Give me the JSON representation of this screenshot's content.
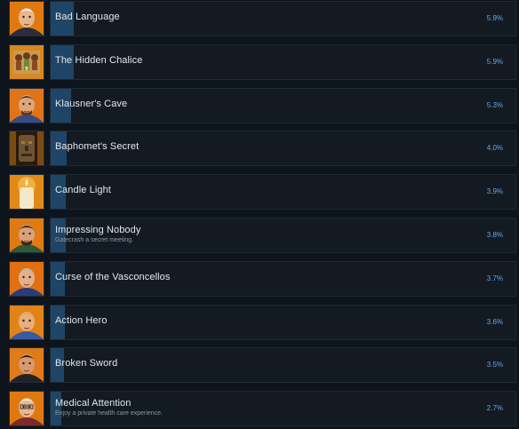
{
  "achievements": [
    {
      "title": "Bad Language",
      "description": "",
      "percent_label": "5.9%",
      "percent": 5.9,
      "icon": "old-man-portrait-icon",
      "colors": {
        "bg": "#e07a10",
        "skin": "#e8b68a",
        "hair": "#f2f2f2",
        "cloth": "#2b2d3a"
      }
    },
    {
      "title": "The Hidden Chalice",
      "description": "",
      "percent_label": "5.9%",
      "percent": 5.9,
      "icon": "chalice-mural-icon",
      "colors": {
        "bg": "#d8881e",
        "skin": "#c68656",
        "hair": "#6b3b1a",
        "cloth": "#8a4a20"
      }
    },
    {
      "title": "Klausner's Cave",
      "description": "",
      "percent_label": "5.3%",
      "percent": 5.3,
      "icon": "bearded-man-portrait-icon",
      "colors": {
        "bg": "#e0741a",
        "skin": "#e2a57a",
        "hair": "#5a3b26",
        "cloth": "#3a4b85"
      }
    },
    {
      "title": "Baphomet's Secret",
      "description": "",
      "percent_label": "4.0%",
      "percent": 4.0,
      "icon": "baphomet-idol-icon",
      "colors": {
        "bg": "#7a4a14",
        "skin": "#6e5436",
        "hair": "#3b2a18",
        "cloth": "#b07a28"
      }
    },
    {
      "title": "Candle Light",
      "description": "",
      "percent_label": "3.9%",
      "percent": 3.9,
      "icon": "candle-icon",
      "colors": {
        "bg": "#e08a1a",
        "skin": "#f4e8c8",
        "hair": "#fff4c0",
        "cloth": "#d8c8a0"
      }
    },
    {
      "title": "Impressing Nobody",
      "description": "Gatecrash a secret meeting.",
      "percent_label": "3.8%",
      "percent": 3.8,
      "icon": "mustached-man-portrait-icon",
      "colors": {
        "bg": "#e07a12",
        "skin": "#d8a27a",
        "hair": "#3a2416",
        "cloth": "#2e5a36"
      }
    },
    {
      "title": "Curse of the Vasconcellos",
      "description": "",
      "percent_label": "3.7%",
      "percent": 3.7,
      "icon": "grey-haired-man-portrait-icon",
      "colors": {
        "bg": "#e07012",
        "skin": "#e2b08a",
        "hair": "#b8b8b8",
        "cloth": "#2a3c78"
      }
    },
    {
      "title": "Action Hero",
      "description": "",
      "percent_label": "3.6%",
      "percent": 3.6,
      "icon": "blond-hero-portrait-icon",
      "colors": {
        "bg": "#e08418",
        "skin": "#e8ae7e",
        "hair": "#e2b040",
        "cloth": "#3a5aa0"
      }
    },
    {
      "title": "Broken Sword",
      "description": "",
      "percent_label": "3.5%",
      "percent": 3.5,
      "icon": "dark-haired-man-portrait-icon",
      "colors": {
        "bg": "#e07a1a",
        "skin": "#d89a70",
        "hair": "#1e1a18",
        "cloth": "#202428"
      }
    },
    {
      "title": "Medical Attention",
      "description": "Enjoy a private health care experience.",
      "percent_label": "2.7%",
      "percent": 2.7,
      "icon": "old-man-glasses-portrait-icon",
      "colors": {
        "bg": "#e07810",
        "skin": "#e8b890",
        "hair": "#f0f0f0",
        "cloth": "#7a2a2a"
      }
    }
  ]
}
